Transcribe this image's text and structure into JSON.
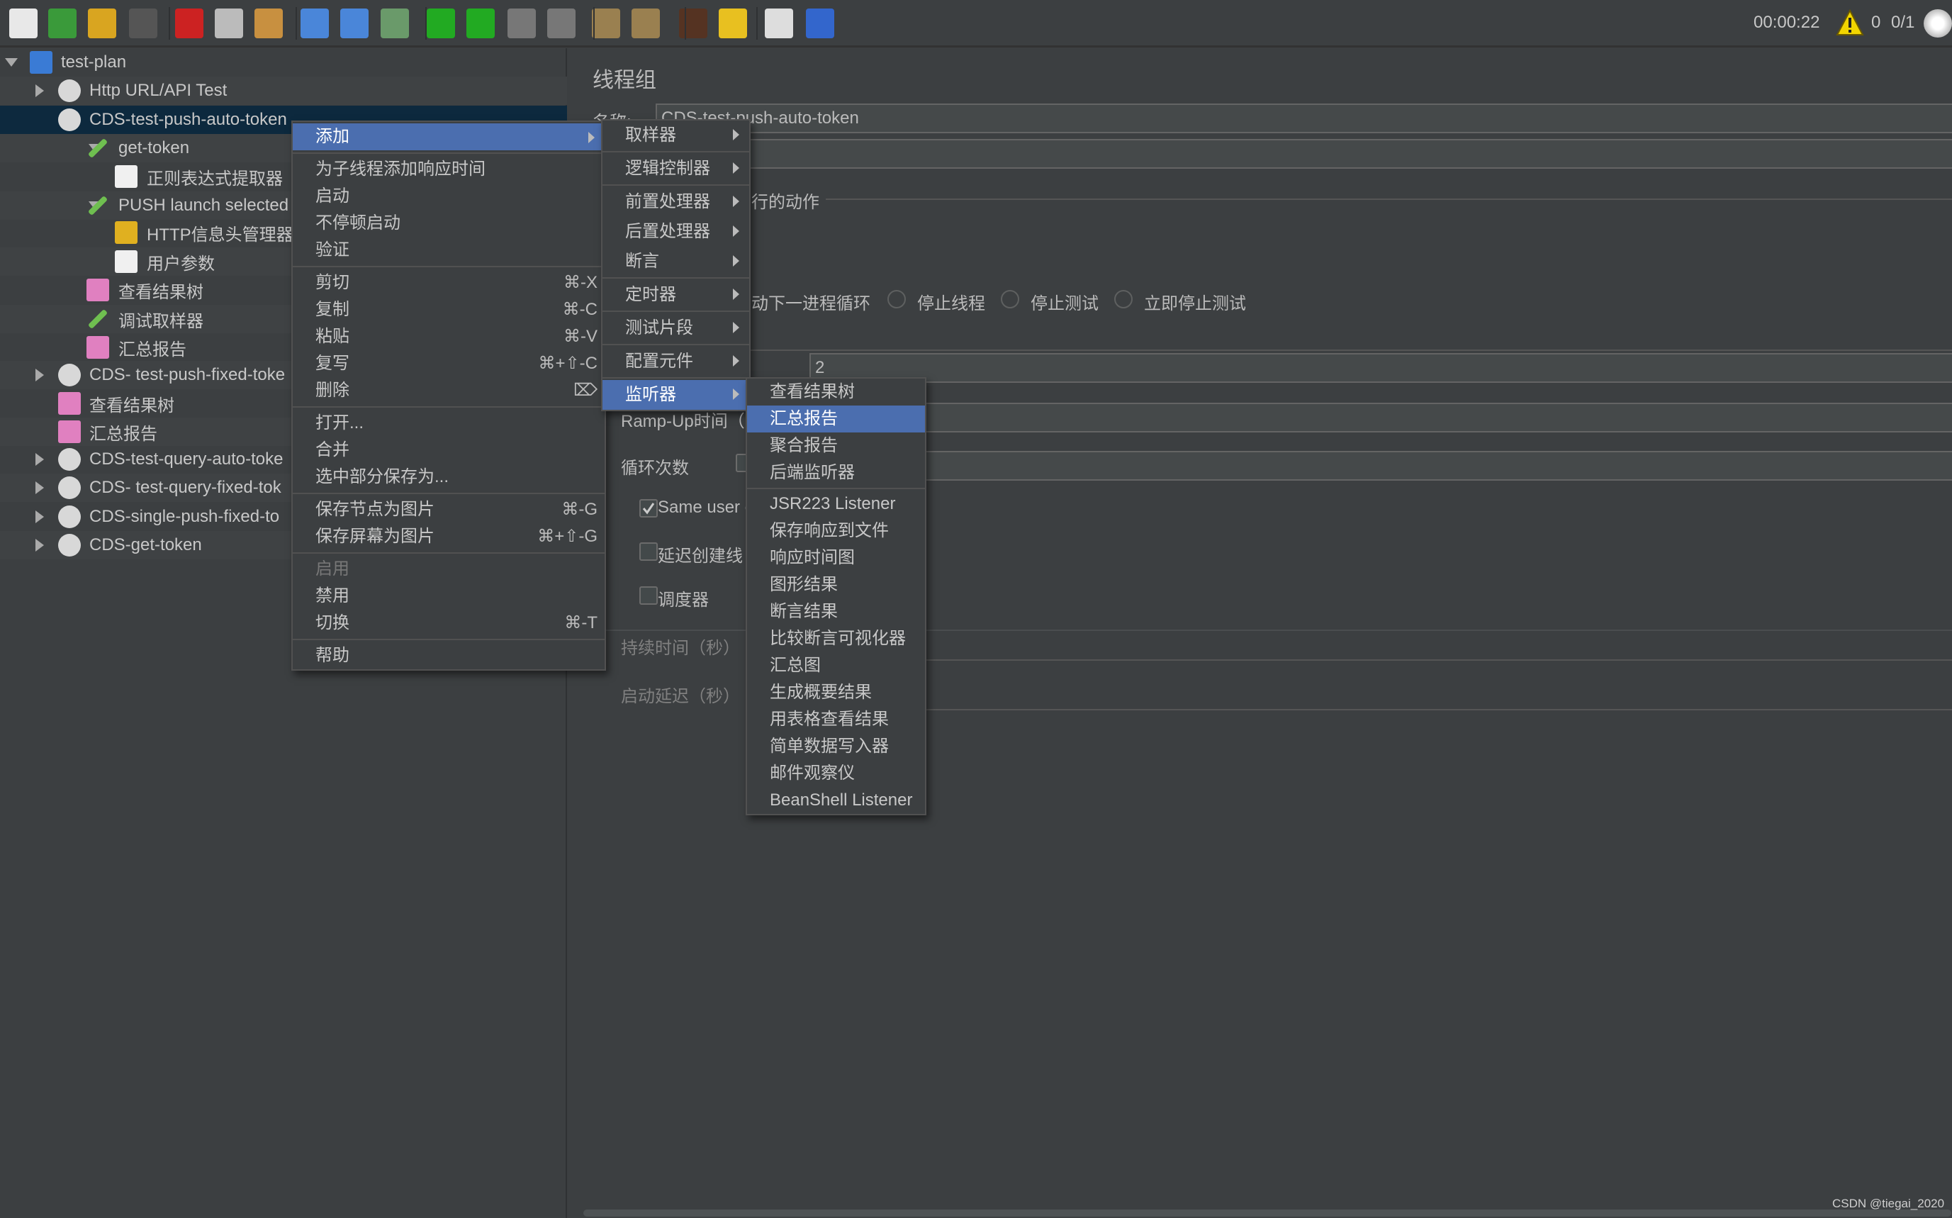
{
  "toolbar": {
    "icons": [
      "new-icon",
      "templates-icon",
      "open-icon",
      "save-icon",
      "cut-icon",
      "copy-icon",
      "paste-icon",
      "expand-icon",
      "collapse-icon",
      "toggle-icon",
      "start-icon",
      "start-no-pause-icon",
      "stop-icon",
      "shutdown-icon",
      "clear-icon",
      "clear-all-icon",
      "search-icon",
      "reset-search-icon",
      "function-helper-icon",
      "help-icon"
    ],
    "timer": "00:00:22",
    "warnings": "0",
    "threads": "0/1"
  },
  "tree": [
    {
      "label": "test-plan"
    },
    {
      "label": "Http URL/API Test"
    },
    {
      "label": "CDS-test-push-auto-token"
    },
    {
      "label": "get-token"
    },
    {
      "label": "正则表达式提取器"
    },
    {
      "label": "PUSH launch selected"
    },
    {
      "label": "HTTP信息头管理器"
    },
    {
      "label": "用户参数"
    },
    {
      "label": "查看结果树"
    },
    {
      "label": "调试取样器"
    },
    {
      "label": "汇总报告"
    },
    {
      "label": "CDS- test-push-fixed-toke"
    },
    {
      "label": "查看结果树"
    },
    {
      "label": "汇总报告"
    },
    {
      "label": "CDS-test-query-auto-toke"
    },
    {
      "label": "CDS- test-query-fixed-tok"
    },
    {
      "label": "CDS-single-push-fixed-to"
    },
    {
      "label": "CDS-get-token"
    }
  ],
  "panel": {
    "title": "线程组",
    "name_label": "名称:",
    "name_value": "CDS-test-push-auto-token",
    "error_action_fragment": "行的动作",
    "next_loop_fragment": "动下一进程循环",
    "stop_thread": "停止线程",
    "stop_test": "停止测试",
    "stop_test_now": "立即停止测试",
    "thread_count": "2",
    "rampup_label": "Ramp-Up时间（",
    "loop_label": "循环次数",
    "same_user_fragment": "Same user o",
    "same_user_checked": true,
    "delay_fragment": "延迟创建线",
    "scheduler": "调度器",
    "duration": "持续时间（秒）",
    "startup_delay": "启动延迟（秒）"
  },
  "context_menu": [
    {
      "label": "添加",
      "submenu": true,
      "highlighted": true
    },
    {
      "sep": true
    },
    {
      "label": "为子线程添加响应时间"
    },
    {
      "label": "启动"
    },
    {
      "label": "不停顿启动"
    },
    {
      "label": "验证"
    },
    {
      "sep": true
    },
    {
      "label": "剪切",
      "shortcut": "⌘-X"
    },
    {
      "label": "复制",
      "shortcut": "⌘-C"
    },
    {
      "label": "粘贴",
      "shortcut": "⌘-V"
    },
    {
      "label": "复写",
      "shortcut": "⌘+⇧-C"
    },
    {
      "label": "删除",
      "shortcut": "⌦"
    },
    {
      "sep": true
    },
    {
      "label": "打开..."
    },
    {
      "label": "合并"
    },
    {
      "label": "选中部分保存为..."
    },
    {
      "sep": true
    },
    {
      "label": "保存节点为图片",
      "shortcut": "⌘-G"
    },
    {
      "label": "保存屏幕为图片",
      "shortcut": "⌘+⇧-G"
    },
    {
      "sep": true
    },
    {
      "label": "启用",
      "disabled": true
    },
    {
      "label": "禁用"
    },
    {
      "label": "切换",
      "shortcut": "⌘-T"
    },
    {
      "sep": true
    },
    {
      "label": "帮助"
    }
  ],
  "add_menu": [
    {
      "label": "取样器",
      "submenu": true
    },
    {
      "sep": true
    },
    {
      "label": "逻辑控制器",
      "submenu": true
    },
    {
      "sep": true
    },
    {
      "label": "前置处理器",
      "submenu": true
    },
    {
      "label": "后置处理器",
      "submenu": true
    },
    {
      "label": "断言",
      "submenu": true
    },
    {
      "sep": true
    },
    {
      "label": "定时器",
      "submenu": true
    },
    {
      "sep": true
    },
    {
      "label": "测试片段",
      "submenu": true
    },
    {
      "sep": true
    },
    {
      "label": "配置元件",
      "submenu": true
    },
    {
      "sep": true
    },
    {
      "label": "监听器",
      "submenu": true,
      "highlighted": true
    }
  ],
  "listener_menu": [
    {
      "label": "查看结果树"
    },
    {
      "label": "汇总报告",
      "highlighted": true
    },
    {
      "label": "聚合报告"
    },
    {
      "label": "后端监听器"
    },
    {
      "sep": true
    },
    {
      "label": "JSR223 Listener"
    },
    {
      "label": "保存响应到文件"
    },
    {
      "label": "响应时间图"
    },
    {
      "label": "图形结果"
    },
    {
      "label": "断言结果"
    },
    {
      "label": "比较断言可视化器"
    },
    {
      "label": "汇总图"
    },
    {
      "label": "生成概要结果"
    },
    {
      "label": "用表格查看结果"
    },
    {
      "label": "简单数据写入器"
    },
    {
      "label": "邮件观察仪"
    },
    {
      "label": "BeanShell Listener"
    }
  ],
  "watermark": "CSDN @tiegai_2020",
  "colors": {
    "background": "#3c3f41",
    "selection": "#0d293e",
    "menu_highlight": "#4b6eaf",
    "warning": "#f2d500"
  }
}
